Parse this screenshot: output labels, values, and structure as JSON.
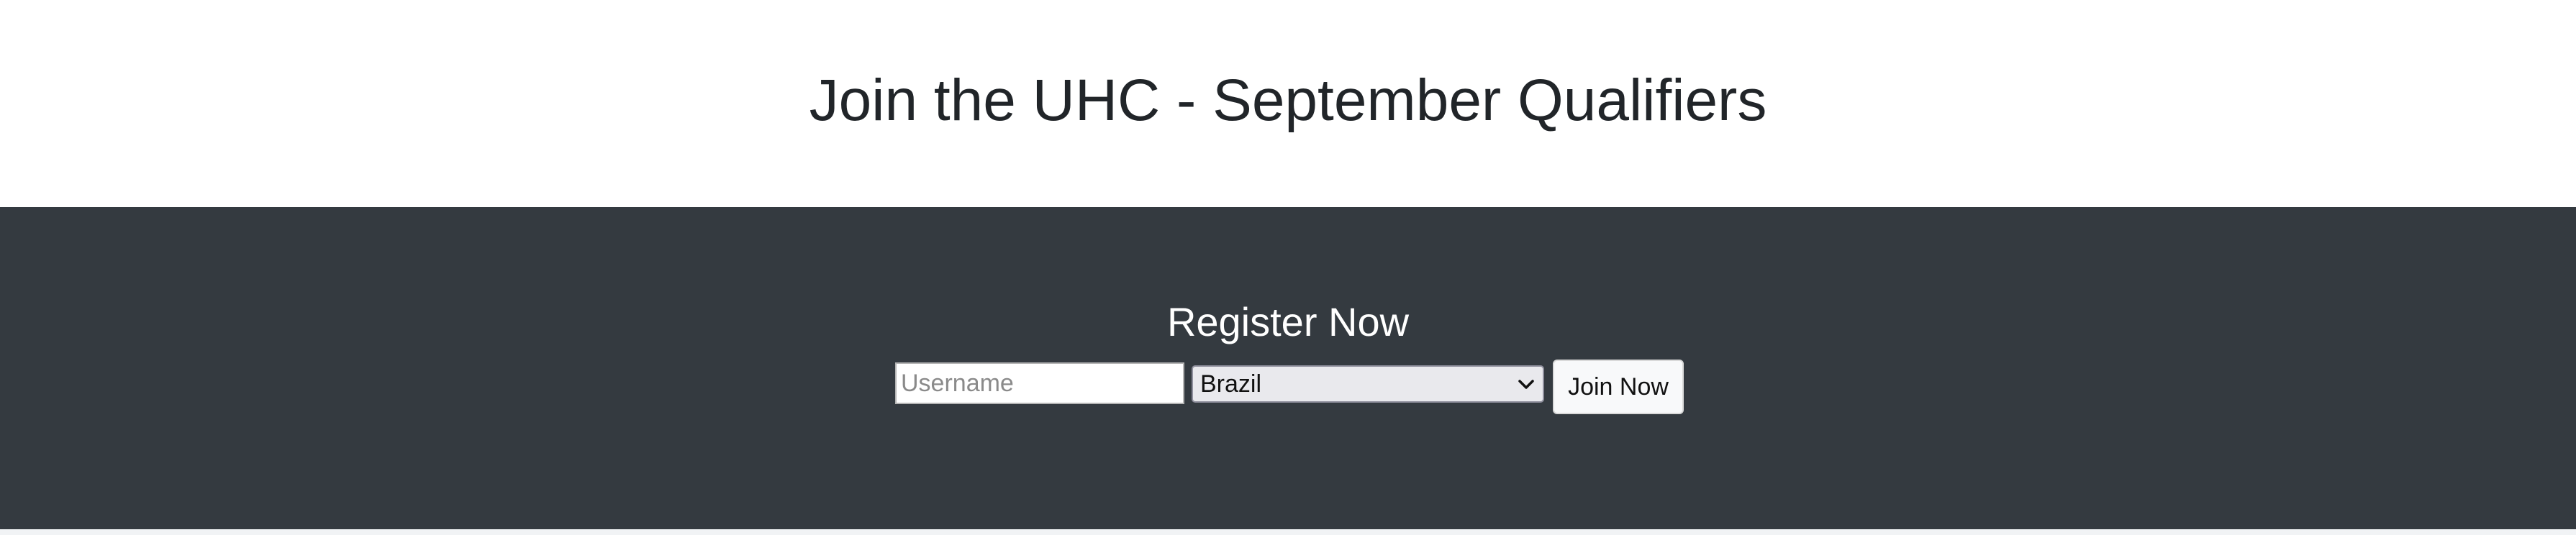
{
  "header": {
    "title": "Join the UHC - September Qualifiers"
  },
  "register": {
    "heading": "Register Now",
    "username_placeholder": "Username",
    "username_value": "",
    "country_selected": "Brazil",
    "join_button_label": "Join Now"
  },
  "colors": {
    "band_background": "#343a40",
    "title_text": "#212529",
    "button_background": "#f8f9fa"
  },
  "icons": {
    "select_arrow": "chevron-down-icon"
  }
}
